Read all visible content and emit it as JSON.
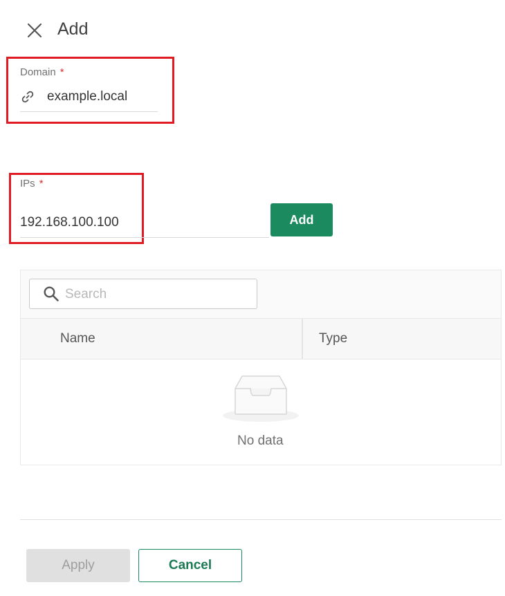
{
  "header": {
    "title": "Add",
    "close_icon": "close-icon"
  },
  "domain_field": {
    "label": "Domain",
    "required_mark": "*",
    "icon": "link-icon",
    "value": "example.local"
  },
  "ips_field": {
    "label": "IPs",
    "required_mark": "*",
    "value": "192.168.100.100",
    "add_label": "Add"
  },
  "table": {
    "search": {
      "placeholder": "Search",
      "icon": "search-icon"
    },
    "columns": [
      "Name",
      "Type"
    ],
    "empty_text": "No data"
  },
  "footer": {
    "apply_label": "Apply",
    "cancel_label": "Cancel"
  },
  "colors": {
    "accent": "#1b8a5f",
    "highlight": "#e01b24",
    "required": "#e03030",
    "disabled": "#e0e0e0"
  }
}
